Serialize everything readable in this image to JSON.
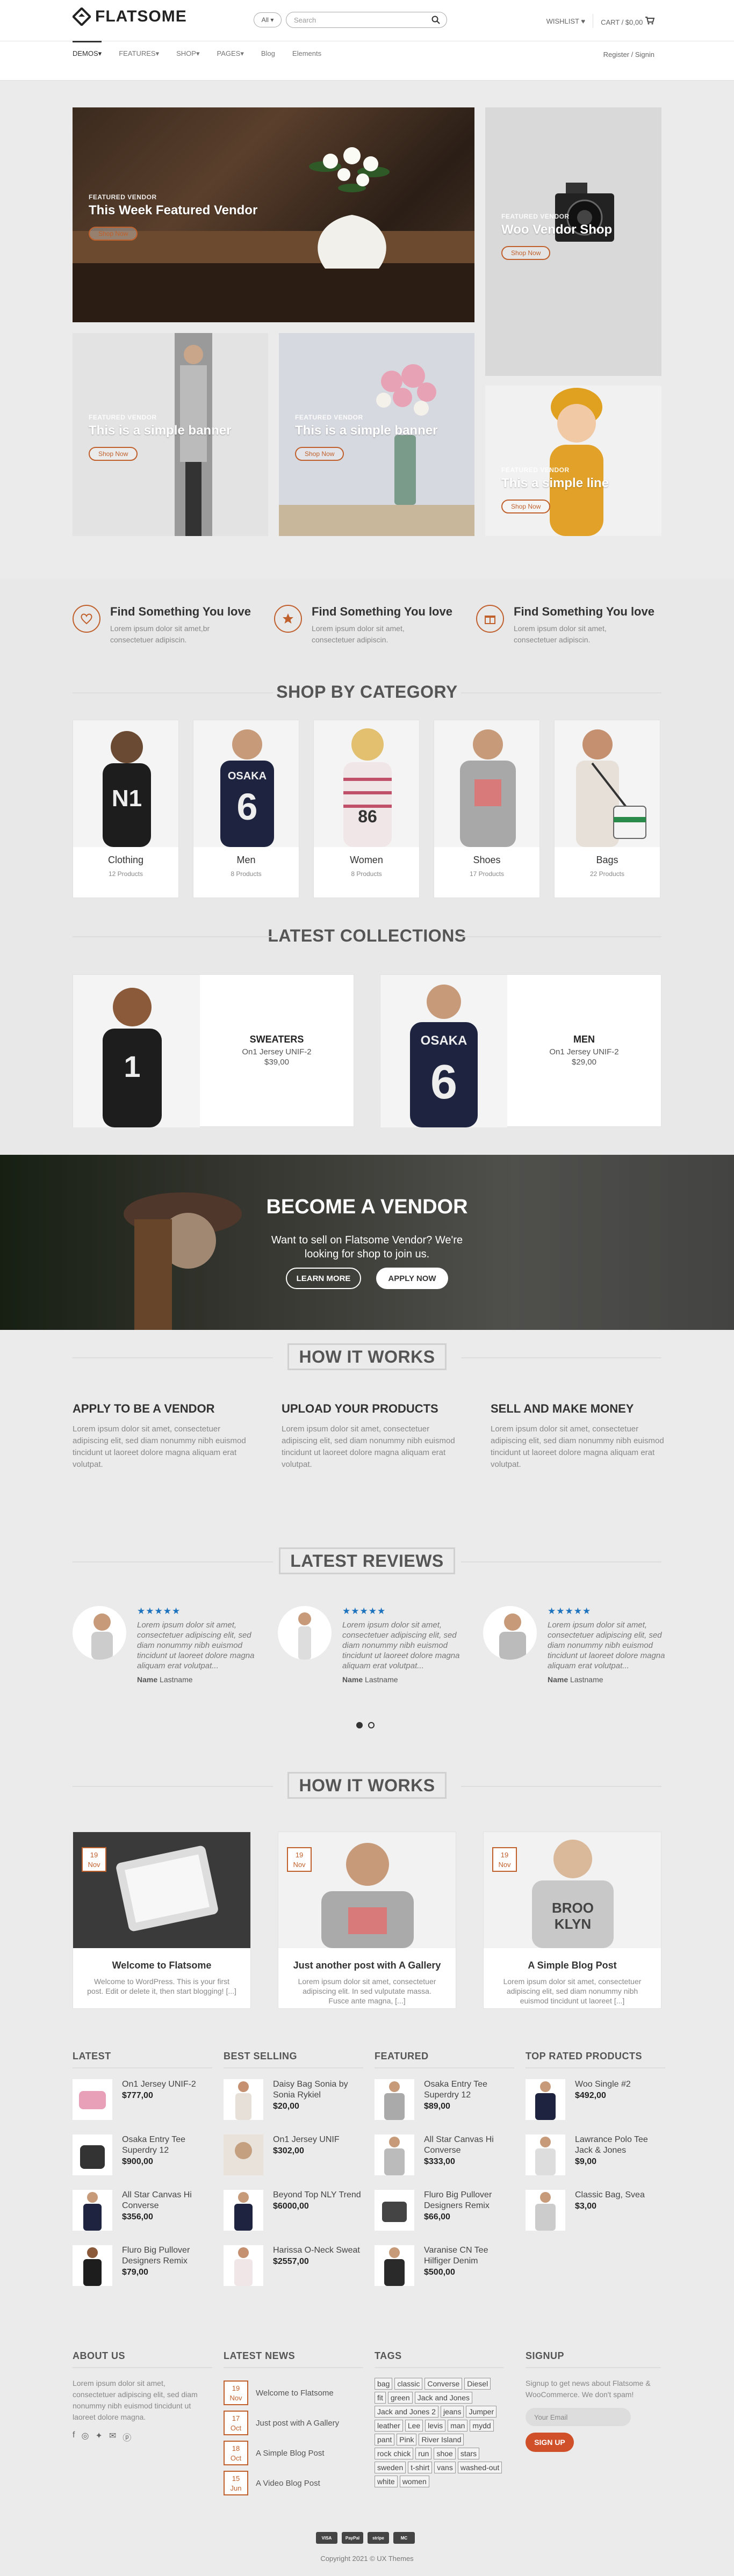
{
  "header": {
    "logo": "FLATSOME",
    "search_select": "All",
    "search_placeholder": "Search",
    "wishlist": "WISHLIST",
    "cart": "CART / $0,00",
    "nav": [
      "DEMOS",
      "FEATURES",
      "SHOP",
      "PAGES",
      "Blog",
      "Elements"
    ],
    "register": "Register / Signin"
  },
  "banners": [
    {
      "small": "FEATURED VENDOR",
      "big": "This Week Featured Vendor",
      "button": "Shop Now"
    },
    {
      "small": "FEATURED VENDOR",
      "big": "Woo Vendor Shop",
      "button": "Shop Now"
    },
    {
      "small": "FEATURED VENDOR",
      "big": "This is a simple banner",
      "button": "Shop Now"
    },
    {
      "small": "FEATURED VENDOR",
      "big": "This is a simple banner",
      "button": "Shop Now"
    },
    {
      "small": "FEATURED VENDOR",
      "big": "This a simple line",
      "button": "Shop Now"
    }
  ],
  "features": [
    {
      "title": "Find Something You love",
      "text": "Lorem ipsum dolor sit amet,br consectetuer adipiscin."
    },
    {
      "title": "Find Something You love",
      "text": "Lorem ipsum dolor sit amet, consectetuer adipiscin."
    },
    {
      "title": "Find Something You love",
      "text": "Lorem ipsum dolor sit amet, consectetuer adipiscin."
    }
  ],
  "shop_by_category": "SHOP BY CATEGORY",
  "categories": [
    {
      "name": "Clothing",
      "count": "12 Products"
    },
    {
      "name": "Men",
      "count": "8 Products"
    },
    {
      "name": "Women",
      "count": "8 Products"
    },
    {
      "name": "Shoes",
      "count": "17 Products"
    },
    {
      "name": "Bags",
      "count": "22 Products"
    }
  ],
  "latest_collections": "LATEST COLLECTIONS",
  "collections": [
    {
      "name": "SWEATERS",
      "sub": "On1 Jersey UNIF-2",
      "price": "$39,00"
    },
    {
      "name": "MEN",
      "sub": "On1 Jersey UNIF-2",
      "price": "$29,00"
    }
  ],
  "vendor": {
    "title": "BECOME A VENDOR",
    "text1": "Want to sell on Flatsome Vendor? We're",
    "text2": "looking for shop to join us.",
    "learn_more": "LEARN MORE",
    "apply_now": "APPLY NOW"
  },
  "how_title": "HOW IT WORKS",
  "how": [
    {
      "title": "APPLY TO BE A VENDOR",
      "text": "Lorem ipsum dolor sit amet, consectetuer adipiscing elit, sed diam nonummy nibh euismod tincidunt ut laoreet dolore magna aliquam erat volutpat."
    },
    {
      "title": "UPLOAD YOUR PRODUCTS",
      "text": "Lorem ipsum dolor sit amet, consectetuer adipiscing elit, sed diam nonummy nibh euismod tincidunt ut laoreet dolore magna aliquam erat volutpat."
    },
    {
      "title": "SELL AND MAKE MONEY",
      "text": "Lorem ipsum dolor sit amet, consectetuer adipiscing elit, sed diam nonummy nibh euismod tincidunt ut laoreet dolore magna aliquam erat volutpat."
    }
  ],
  "latest_reviews": "LATEST REVIEWS",
  "reviews": [
    {
      "stars": "★★★★★",
      "text": "Lorem ipsum dolor sit amet, consectetuer adipiscing elit, sed diam nonummy nibh euismod tincidunt ut laoreet dolore magna aliquam erat volutpat...",
      "name": "Name",
      "last": "Lastname"
    },
    {
      "stars": "★★★★★",
      "text": "Lorem ipsum dolor sit amet, consectetuer adipiscing elit, sed diam nonummy nibh euismod tincidunt ut laoreet dolore magna aliquam erat volutpat...",
      "name": "Name",
      "last": "Lastname"
    },
    {
      "stars": "★★★★★",
      "text": "Lorem ipsum dolor sit amet, consectetuer adipiscing elit, sed diam nonummy nibh euismod tincidunt ut laoreet dolore magna aliquam erat volutpat...",
      "name": "Name",
      "last": "Lastname"
    }
  ],
  "how_title2": "HOW IT WORKS",
  "posts": [
    {
      "day": "19",
      "month": "Nov",
      "title": "Welcome to Flatsome",
      "excerpt": "Welcome to WordPress. This is your first post. Edit or delete it, then start blogging! [...]"
    },
    {
      "day": "19",
      "month": "Nov",
      "title": "Just another post with A Gallery",
      "excerpt": "Lorem ipsum dolor sit amet, consectetuer adipiscing elit. In sed vulputate massa. Fusce ante magna, [...]"
    },
    {
      "day": "19",
      "month": "Nov",
      "title": "A Simple Blog Post",
      "excerpt": "Lorem ipsum dolor sit amet, consectetuer adipiscing elit, sed diam nonummy nibh euismod tincidunt ut laoreet [...]"
    }
  ],
  "product_lists": [
    {
      "title": "LATEST",
      "items": [
        {
          "name": "On1 Jersey UNIF-2",
          "price": "$777,00"
        },
        {
          "name": "Osaka Entry Tee Superdry 12",
          "price": "$900,00"
        },
        {
          "name": "All Star Canvas Hi Converse",
          "price": "$356,00"
        },
        {
          "name": "Fluro Big Pullover Designers Remix",
          "price": "$79,00"
        }
      ]
    },
    {
      "title": "BEST SELLING",
      "items": [
        {
          "name": "Daisy Bag Sonia by Sonia Rykiel",
          "price": "$20,00"
        },
        {
          "name": "On1 Jersey UNIF",
          "price": "$302,00"
        },
        {
          "name": "Beyond Top NLY Trend",
          "price": "$6000,00"
        },
        {
          "name": "Harissa O-Neck Sweat",
          "price": "$2557,00"
        }
      ]
    },
    {
      "title": "FEATURED",
      "items": [
        {
          "name": "Osaka Entry Tee Superdry 12",
          "price": "$89,00"
        },
        {
          "name": "All Star Canvas Hi Converse",
          "price": "$333,00"
        },
        {
          "name": "Fluro Big Pullover Designers Remix",
          "price": "$66,00"
        },
        {
          "name": "Varanise CN Tee Hilfiger Denim",
          "price": "$500,00"
        }
      ]
    },
    {
      "title": "TOP RATED PRODUCTS",
      "items": [
        {
          "name": "Woo Single #2",
          "price": "$492,00"
        },
        {
          "name": "Lawrance Polo Tee Jack & Jones",
          "price": "$9,00"
        },
        {
          "name": "Classic Bag, Svea",
          "price": "$3,00"
        }
      ]
    }
  ],
  "footer": {
    "about_title": "ABOUT US",
    "about_text": "Lorem ipsum dolor sit amet, consectetuer adipiscing elit, sed diam nonummy nibh euismod tincidunt ut laoreet dolore magna.",
    "news_title": "LATEST NEWS",
    "news": [
      {
        "day": "19",
        "month": "Nov",
        "label": "Welcome to Flatsome"
      },
      {
        "day": "17",
        "month": "Oct",
        "label": "Just post with A Gallery"
      },
      {
        "day": "18",
        "month": "Oct",
        "label": "A Simple Blog Post"
      },
      {
        "day": "15",
        "month": "Jun",
        "label": "A Video Blog Post"
      }
    ],
    "tags_title": "TAGS",
    "tags": [
      "bag",
      "classic",
      "Converse",
      "Diesel",
      "fit",
      "green",
      "Jack and Jones",
      "Jack and Jones 2",
      "jeans",
      "Jumper",
      "leather",
      "Lee",
      "levis",
      "man",
      "mydd",
      "pant",
      "Pink",
      "River Island",
      "rock chick",
      "run",
      "shoe",
      "stars",
      "sweden",
      "t-shirt",
      "vans",
      "washed-out",
      "white",
      "women"
    ],
    "signup_title": "SIGNUP",
    "signup_text": "Signup to get news about Flatsome & WooCommerce. We don't spam!",
    "email_placeholder": "Your Email",
    "signup_button": "SIGN UP",
    "payments": [
      "VISA",
      "PayPal",
      "stripe",
      "MC"
    ],
    "copyright": "Copyright 2021 © UX Themes"
  },
  "colors": {
    "accent": "#c0602c",
    "star": "#1e73be",
    "bg": "#ebebeb"
  }
}
